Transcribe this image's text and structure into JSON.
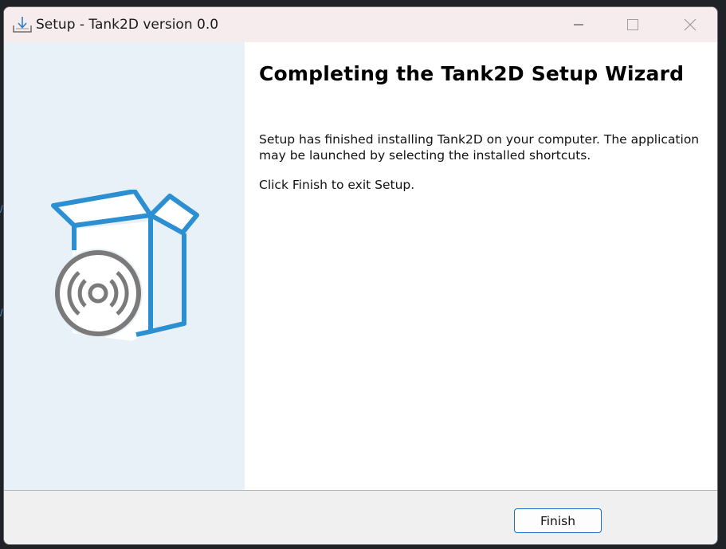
{
  "window": {
    "title": "Setup - Tank2D version 0.0"
  },
  "wizard": {
    "heading": "Completing the Tank2D Setup Wizard",
    "paragraph1": "Setup has finished installing Tank2D on your computer. The application may be launched by selecting the installed shortcuts.",
    "paragraph2": "Click Finish to exit Setup."
  },
  "buttons": {
    "finish_label": "Finish"
  },
  "icons": {
    "app": "setup-download-icon",
    "minimize": "minimize-icon",
    "maximize": "maximize-icon",
    "close": "close-icon",
    "illustration": "box-with-disc-icon"
  },
  "colors": {
    "titlebar": "#f7eced",
    "left_panel": "#e8f1f8",
    "box_outline": "#2b8fd2",
    "disc": "#7a7a7a",
    "finish_border": "#1f6dbf"
  }
}
